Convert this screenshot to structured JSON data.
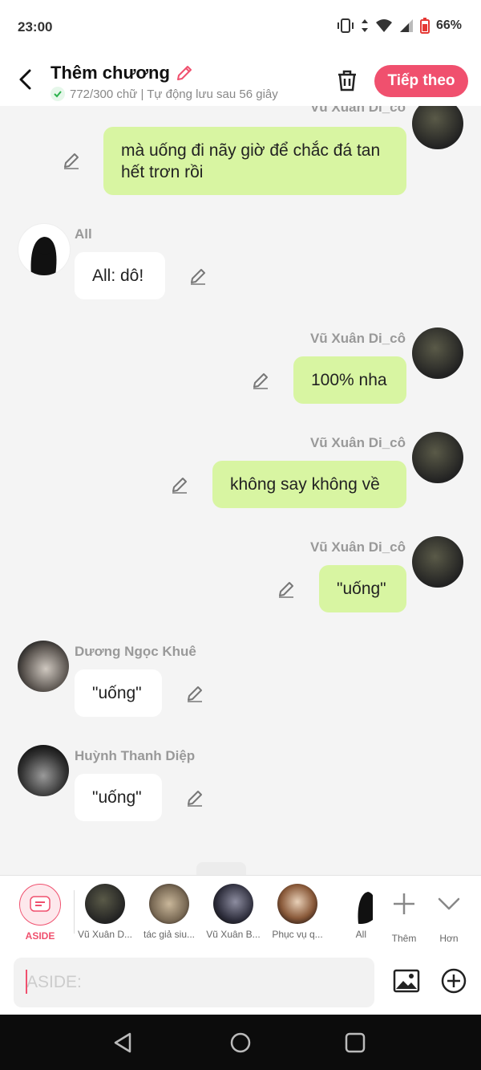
{
  "status": {
    "time": "23:00",
    "battery": "66%"
  },
  "header": {
    "title": "Thêm chương",
    "subtitle": "772/300 chữ | Tự động lưu sau 56 giây",
    "next_label": "Tiếp theo"
  },
  "messages": [
    {
      "side": "right",
      "name": "Vũ Xuân Di_cô",
      "text": "mà uống đi nãy giờ để chắc đá tan hết trơn rồi"
    },
    {
      "side": "left",
      "name": "All",
      "text": "All: dô!"
    },
    {
      "side": "right",
      "name": "Vũ Xuân Di_cô",
      "text": "100% nha"
    },
    {
      "side": "right",
      "name": "Vũ Xuân Di_cô",
      "text": "không say không về"
    },
    {
      "side": "right",
      "name": "Vũ Xuân Di_cô",
      "text": "\"uống\""
    },
    {
      "side": "left",
      "name": "Dương Ngọc Khuê",
      "text": "\"uống\""
    },
    {
      "side": "left",
      "name": "Huỳnh Thanh Diệp",
      "text": "\"uống\""
    }
  ],
  "characters": [
    {
      "label": "ASIDE",
      "icon": "aside-icon"
    },
    {
      "label": "Vũ Xuân D..."
    },
    {
      "label": "tác giả siu..."
    },
    {
      "label": "Vũ Xuân B..."
    },
    {
      "label": "Phục vụ q..."
    },
    {
      "label": "All"
    },
    {
      "label": "Thêm",
      "icon": "plus-icon"
    },
    {
      "label": "Hơn",
      "icon": "chevron-down-icon"
    }
  ],
  "input": {
    "placeholder": "ASIDE:"
  },
  "colors": {
    "accent": "#f0506e",
    "bubble_right": "#d8f5a2",
    "bubble_left": "#ffffff",
    "background": "#f4f4f4"
  }
}
